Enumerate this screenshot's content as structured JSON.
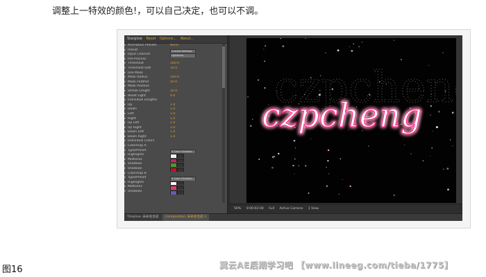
{
  "caption": "调整上一特效的颜色!，可以自己决定，也可以不调。",
  "figure_label": "图16",
  "watermark": "翼云AE后期学习吧 【www.lineeg.com/tieba/1775】",
  "screenshot": {
    "effect_panel": {
      "effect_name": "Starglow",
      "header_links": [
        "Reset",
        "Options...",
        "About..."
      ],
      "properties": [
        {
          "label": "Animation Presets",
          "value": "None"
        },
        {
          "label": "Preset",
          "dropdown": "Current Settings"
        },
        {
          "label": "Input Channel",
          "dropdown": "Lightness"
        },
        {
          "label": "Pre-Process"
        },
        {
          "label": "Threshold",
          "value": "160.0"
        },
        {
          "label": "Threshold Soft",
          "value": "10.0"
        },
        {
          "label": "Use Mask"
        },
        {
          "label": "Mask Radius",
          "value": "100.0"
        },
        {
          "label": "Mask Feather",
          "value": "50.0"
        },
        {
          "label": "Mask Position"
        },
        {
          "label": "Streak Length",
          "value": "20.0"
        },
        {
          "label": "Boost Light",
          "value": "0.0"
        },
        {
          "label": "Individual Lengths"
        },
        {
          "label": "Up",
          "value": "1.0"
        },
        {
          "label": "Down",
          "value": "1.0"
        },
        {
          "label": "Left",
          "value": "1.0"
        },
        {
          "label": "Right",
          "value": "1.0"
        },
        {
          "label": "Up Left",
          "value": "1.0"
        },
        {
          "label": "Up Right",
          "value": "1.0"
        },
        {
          "label": "Down Left",
          "value": "1.0"
        },
        {
          "label": "Down Right",
          "value": "1.0"
        },
        {
          "label": "Individual Colors"
        },
        {
          "label": "Colormap A"
        },
        {
          "label": "Type/Preset",
          "dropdown": "3-Color Gradient"
        },
        {
          "label": "Highlights",
          "color": "#f2f2f2"
        },
        {
          "label": "Midtones",
          "color": "#c8255a"
        },
        {
          "label": "Shadows",
          "color": "#4a9a2a"
        },
        {
          "label": "Shadows",
          "color": "#b01830"
        },
        {
          "label": "Colormap B"
        },
        {
          "label": "Type/Preset",
          "dropdown": "3-Color Gradient"
        },
        {
          "label": "Highlights",
          "color": "#ffffff"
        },
        {
          "label": "Midtones",
          "color": "#d63a7a"
        },
        {
          "label": "Shadows",
          "color": "#6a5ab0"
        }
      ]
    },
    "timeline_tabs": [
      "Timeline: 未命名合成",
      "Composition: 未命名合成 1"
    ],
    "viewer": {
      "text": "czpcheng",
      "glow_color": "#ff2a8a",
      "controls": [
        "50%",
        "0:00:02:00",
        "Full",
        "Active Camera",
        "1 View"
      ]
    }
  }
}
